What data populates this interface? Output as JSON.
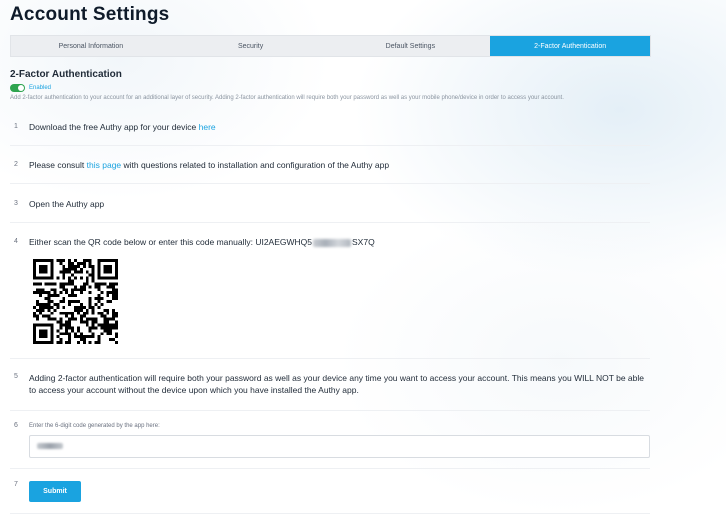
{
  "page": {
    "title": "Account Settings"
  },
  "tabs": [
    {
      "label": "Personal Information"
    },
    {
      "label": "Security"
    },
    {
      "label": "Default Settings"
    },
    {
      "label": "2-Factor Authentication"
    }
  ],
  "section": {
    "title": "2-Factor Authentication",
    "toggle_label": "Enabled",
    "description": "Add 2-factor authentication to your account for an additional layer of security. Adding 2-factor authentication will require both your password as well as your mobile phone/device in order to access your account."
  },
  "steps": [
    {
      "num": "1",
      "text_before": "Download the free Authy app for your device ",
      "link": "here"
    },
    {
      "num": "2",
      "text_before": "Please consult ",
      "link": "this page",
      "text_after": " with questions related to installation and configuration of the Authy app"
    },
    {
      "num": "3",
      "text": "Open the Authy app"
    },
    {
      "num": "4",
      "text_before": "Either scan the QR code below or enter this code manually: UI2AEGWHQ5",
      "text_after": "SX7Q"
    },
    {
      "num": "5",
      "text": "Adding 2-factor authentication will require both your password as well as your device any time you want to access your account. This means you WILL NOT be able to access your account without the device upon which you have installed the Authy app."
    },
    {
      "num": "6",
      "label": "Enter the 6-digit code generated by the app here:"
    },
    {
      "num": "7"
    }
  ],
  "submit_label": "Submit",
  "colors": {
    "accent": "#1aa3e0",
    "toggle_on": "#2ea44f"
  }
}
